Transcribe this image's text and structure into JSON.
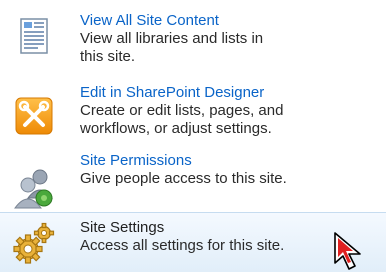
{
  "menu": {
    "items": [
      {
        "title": "View All Site Content",
        "description": "View all libraries and lists in\nthis site.",
        "icon": "document-list-icon"
      },
      {
        "title": "Edit in SharePoint Designer",
        "description": "Create or edit lists, pages, and\nworkflows, or adjust settings.",
        "icon": "tools-icon"
      },
      {
        "title": "Site Permissions",
        "description": "Give people access to this site.",
        "icon": "people-icon"
      },
      {
        "title": "Site Settings",
        "description": "Access all settings for this site.",
        "icon": "gears-icon"
      }
    ],
    "hovered_item": "Site Settings"
  },
  "colors": {
    "link_title": "#0a64c8",
    "description_text": "#2a2a2a",
    "hover_background": "#e1eef9",
    "designer_icon_orange": "#f39a12"
  },
  "cursor": {
    "icon": "mouse-pointer-icon"
  }
}
